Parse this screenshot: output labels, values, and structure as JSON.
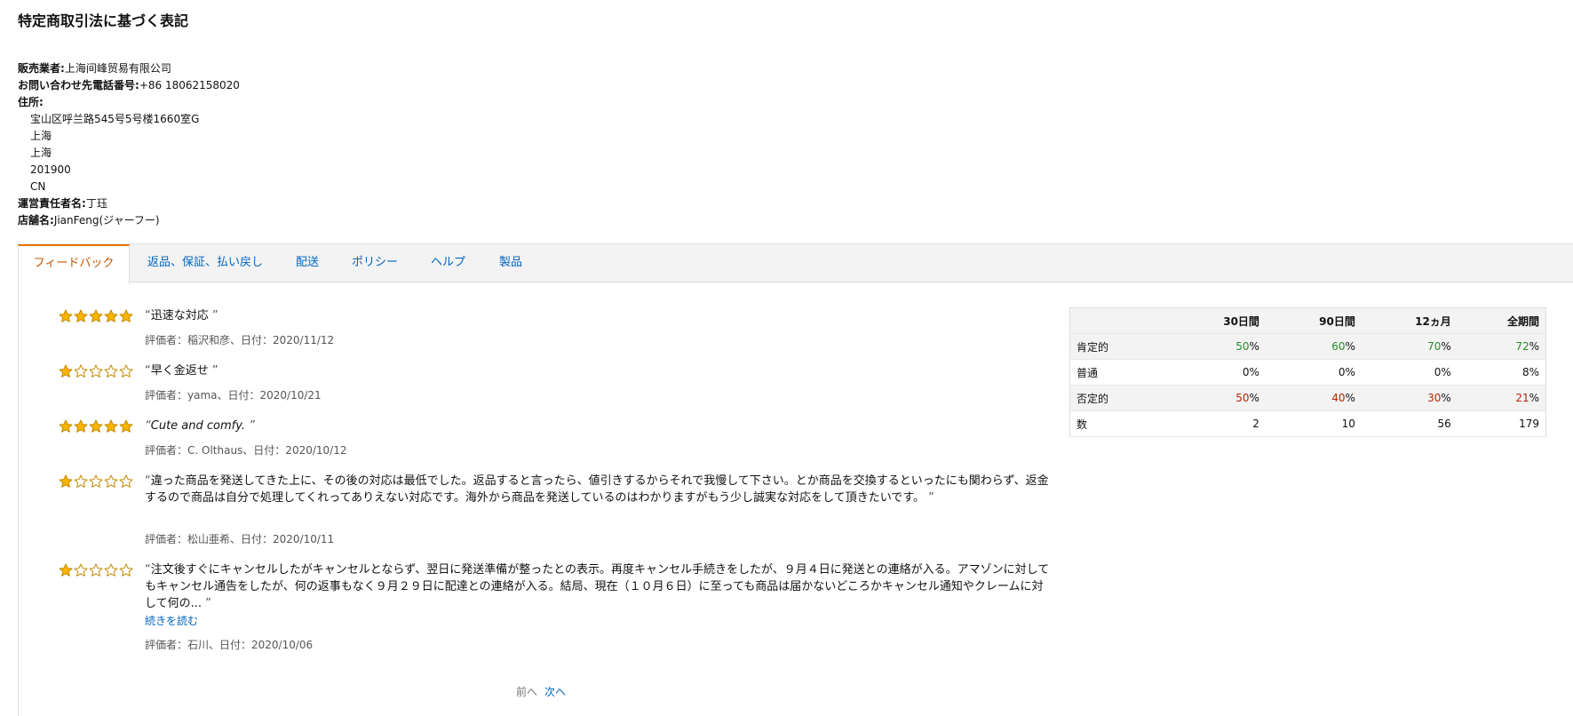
{
  "page_title": "特定商取引法に基づく表記",
  "seller": {
    "seller_label": "販売業者:",
    "seller_value": "上海间峰贸易有限公司",
    "phone_label": "お問い合わせ先電話番号:",
    "phone_value": "+86 18062158020",
    "address_label": "住所:",
    "address_lines": [
      "宝山区呼兰路545号5号楼1660室G",
      "上海",
      "上海",
      "201900",
      "CN"
    ],
    "manager_label": "運営責任者名:",
    "manager_value": "丁珏",
    "store_label": "店舗名:",
    "store_value": "JianFeng(ジャーフー)"
  },
  "tabs": [
    {
      "label": "フィードバック",
      "active": true
    },
    {
      "label": "返品、保証、払い戻し",
      "active": false
    },
    {
      "label": "配送",
      "active": false
    },
    {
      "label": "ポリシー",
      "active": false
    },
    {
      "label": "ヘルプ",
      "active": false
    },
    {
      "label": "製品",
      "active": false
    }
  ],
  "colors": {
    "star_fill": "#f7b500",
    "star_stroke": "#c48a00",
    "link": "#0066c0",
    "active_tab": "#c45500"
  },
  "reviews": [
    {
      "rating": 5,
      "text": "迅速な対応",
      "meta": "評価者：稲沢和彦、日付：2020/11/12"
    },
    {
      "rating": 1,
      "text": "早く金返せ",
      "meta": "評価者：yama、日付：2020/10/21"
    },
    {
      "rating": 5,
      "text": "Cute and comfy.",
      "meta": "評価者：C. Olthaus、日付：2020/10/12"
    },
    {
      "rating": 1,
      "text": "違った商品を発送してきた上に、その後の対応は最低でした。返品すると言ったら、値引きするからそれで我慢して下さい。とか商品を交換するといったにも関わらず、返金するので商品は自分で処理してくれってありえない対応です。海外から商品を発送しているのはわかりますがもう少し誠実な対応をして頂きたいです。",
      "meta": "評価者：松山亜希、日付：2020/10/11"
    },
    {
      "rating": 1,
      "text": "注文後すぐにキャンセルしたがキャンセルとならず、翌日に発送準備が整ったとの表示。再度キャンセル手続きをしたが、９月４日に発送との連絡が入る。アマゾンに対してもキャンセル通告をしたが、何の返事もなく９月２９日に配達との連絡が入る。結局、現在（１０月６日）に至っても商品は届かないどころかキャンセル通知やクレームに対して何の...",
      "meta": "評価者：石川、日付：2020/10/06",
      "read_more": "続きを読む"
    }
  ],
  "pager": {
    "prev": "前へ",
    "next": "次へ"
  },
  "stats": {
    "headers": [
      "30日間",
      "90日間",
      "12ヵ月",
      "全期間"
    ],
    "rows": [
      {
        "label": "肯定的",
        "values": [
          "50",
          "60",
          "70",
          "72"
        ],
        "suffix": "%",
        "tone": "positive"
      },
      {
        "label": "普通",
        "values": [
          "0",
          "0",
          "0",
          "8"
        ],
        "suffix": "%",
        "tone": "neutral"
      },
      {
        "label": "否定的",
        "values": [
          "50",
          "40",
          "30",
          "21"
        ],
        "suffix": "%",
        "tone": "negative"
      },
      {
        "label": "数",
        "values": [
          "2",
          "10",
          "56",
          "179"
        ],
        "suffix": "",
        "tone": "neutral"
      }
    ]
  }
}
